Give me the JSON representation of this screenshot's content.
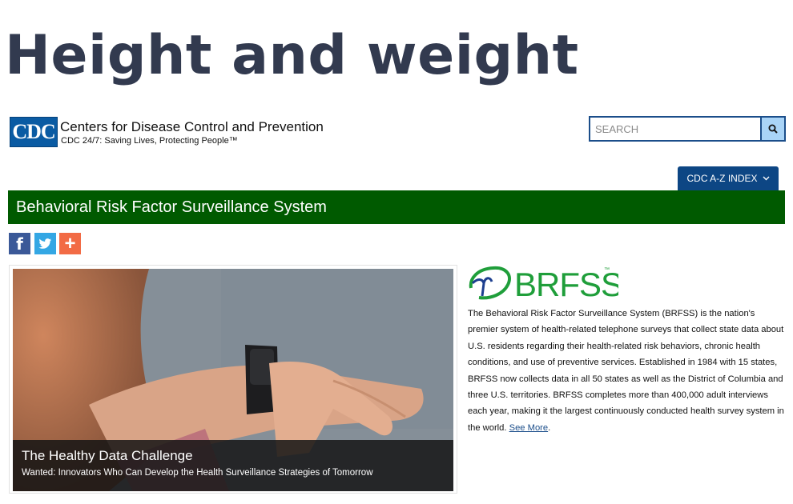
{
  "page": {
    "title": "Height and weight"
  },
  "header": {
    "logo_text": "CDC",
    "org_name": "Centers for Disease Control and Prevention",
    "tagline": "CDC 24/7: Saving Lives, Protecting People™"
  },
  "search": {
    "placeholder": "SEARCH",
    "value": ""
  },
  "az_index": {
    "label": "CDC A-Z INDEX"
  },
  "banner": {
    "title": "Behavioral Risk Factor Surveillance System"
  },
  "share": [
    "facebook",
    "twitter",
    "addthis"
  ],
  "hero": {
    "title": "The Healthy Data Challenge",
    "subtitle": "Wanted: Innovators Who Can Develop the Health Surveillance Strategies of Tomorrow"
  },
  "brfss": {
    "logo_text": "BRFSS",
    "logo_tm": "™",
    "description": "The Behavioral Risk Factor Surveillance System (BRFSS) is the nation's premier system of health-related telephone surveys that collect state data about U.S. residents regarding their health-related risk behaviors, chronic health conditions, and use of preventive services. Established in 1984 with 15 states, BRFSS now collects data in all 50 states as well as the District of Columbia and three U.S. territories. BRFSS completes more than 400,000 adult interviews each year, making it the largest continuously conducted health survey system in the world.",
    "link_label": "See More",
    "link_suffix": "."
  },
  "colors": {
    "title": "#323a4f",
    "banner_green": "#005a00",
    "az_button": "#0d4684",
    "search_button": "#a9d4f7",
    "brfss_blue": "#1d3f8f",
    "brfss_green": "#1f9e3a"
  }
}
